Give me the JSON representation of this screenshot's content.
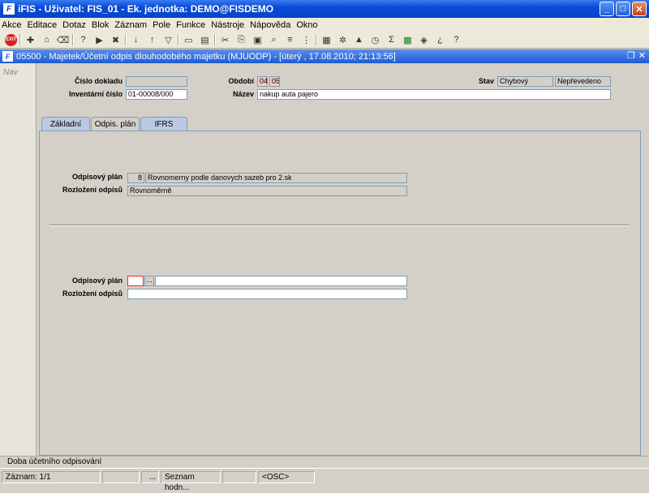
{
  "window": {
    "title": "iFIS - Uživatel: FIS_01 - Ek. jednotka: DEMO@FISDEMO",
    "app_icon": "F"
  },
  "menu": [
    "Akce",
    "Editace",
    "Dotaz",
    "Blok",
    "Záznam",
    "Pole",
    "Funkce",
    "Nástroje",
    "Nápověda",
    "Okno"
  ],
  "toolbar": {
    "exit_label": "EXIT",
    "icons": [
      "exit-icon",
      "sep",
      "add-record-icon",
      "save-icon",
      "clear-icon",
      "sep",
      "enter-query-icon",
      "execute-query-icon",
      "cancel-query-icon",
      "sep",
      "sort-asc-icon",
      "sort-desc-icon",
      "filter-icon",
      "sep",
      "print-icon",
      "print-preview-icon",
      "sep",
      "cut-icon",
      "copy-icon",
      "paste-icon",
      "find-icon",
      "list-icon",
      "columns-icon",
      "sep",
      "calculator-icon",
      "settings-icon",
      "chart-icon",
      "clock-icon",
      "sum-icon",
      "excel-icon",
      "export-icon",
      "help-icon",
      "whats-this-icon"
    ]
  },
  "form": {
    "title": "05500 - Majetek/Účetní odpis dlouhodobého majetku (MJUODP) - [úterý , 17.08.2010; 21:13:56]",
    "nav_label": "Nav",
    "header": {
      "doc_number_label": "Číslo dokladu",
      "doc_number_value": "",
      "inventory_label": "Inventární číslo",
      "inventory_value": "01-00008/000",
      "period_label": "Období",
      "period_month": "04",
      "period_year": "05",
      "name_label": "Název",
      "name_value": "nakup auta pajero",
      "state_label": "Stav",
      "state_value": "Chybový",
      "state_value2": "Nepřevedeno"
    },
    "tabs": [
      "Základní",
      "Odpis. plán",
      "IFRS"
    ],
    "active_tab": "Odpis. plán",
    "upper": {
      "plan_label": "Odpisový plán",
      "plan_code": "8",
      "plan_name": "Rovnomerny podle danovych sazeb pro 2.sk",
      "distribution_label": "Rozložení odpisů",
      "distribution_value": "Rovnoměrně"
    },
    "lower": {
      "plan_label": "Odpisový plán",
      "plan_code": "",
      "lov_label": "...",
      "plan_name": "",
      "distribution_label": "Rozložení odpisů",
      "distribution_value": ""
    }
  },
  "status": {
    "hint": "Doba účetního odpisování",
    "record": "Záznam: 1/1",
    "seg2": "",
    "seg3": "...",
    "list": "Seznam hodn...",
    "seg5": "",
    "mode": "<OSC>"
  }
}
